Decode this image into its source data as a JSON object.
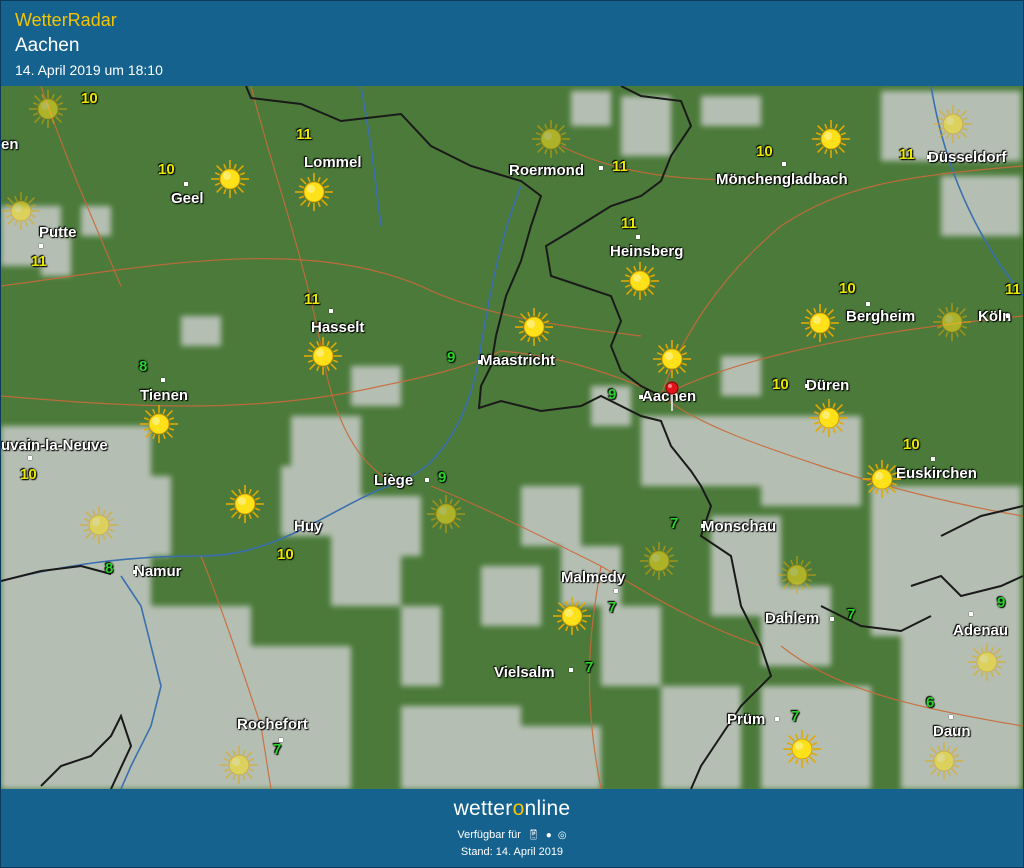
{
  "header": {
    "brand": "WetterRadar",
    "location": "Aachen",
    "datetime": "14. April 2019 um 18:10"
  },
  "colors": {
    "header_bg": "#15628f",
    "brand_accent": "#f5c400",
    "land": "#4b7a3a",
    "cloud": "#c8cbc8",
    "temp_yellow": "#e8e800",
    "temp_green": "#28d42a",
    "border_line": "#1a1a1a",
    "road_line": "#c96a3a",
    "river_line": "#3a6fb0",
    "pin": "#e0141c"
  },
  "map": {
    "cities": [
      {
        "name": "en",
        "dot": false
      },
      {
        "name": "Lommel",
        "dot": false
      },
      {
        "name": "Roermond",
        "dot": true
      },
      {
        "name": "Mönchengladbach",
        "dot": true
      },
      {
        "name": "Düsseldorf",
        "dot": true
      },
      {
        "name": "Geel",
        "dot": true
      },
      {
        "name": "Putte",
        "dot": true
      },
      {
        "name": "Heinsberg",
        "dot": true
      },
      {
        "name": "Hasselt",
        "dot": true
      },
      {
        "name": "Bergheim",
        "dot": true
      },
      {
        "name": "Köln",
        "dot": true
      },
      {
        "name": "Maastricht",
        "dot": true
      },
      {
        "name": "Tienen",
        "dot": true
      },
      {
        "name": "Aachen",
        "dot": true
      },
      {
        "name": "Düren",
        "dot": true
      },
      {
        "name": "uvain-la-Neuve",
        "dot": true
      },
      {
        "name": "Liège",
        "dot": true
      },
      {
        "name": "Euskirchen",
        "dot": true
      },
      {
        "name": "Huy",
        "dot": false
      },
      {
        "name": "Monschau",
        "dot": true
      },
      {
        "name": "Namur",
        "dot": true
      },
      {
        "name": "Malmedy",
        "dot": true
      },
      {
        "name": "Dahlem",
        "dot": true
      },
      {
        "name": "Adenau",
        "dot": true
      },
      {
        "name": "Vielsalm",
        "dot": true
      },
      {
        "name": "Prüm",
        "dot": true
      },
      {
        "name": "Rochefort",
        "dot": true
      },
      {
        "name": "Daun",
        "dot": true
      }
    ],
    "temperatures": [
      {
        "value": "10",
        "color": "yellow"
      },
      {
        "value": "11",
        "color": "yellow"
      },
      {
        "value": "10",
        "color": "yellow"
      },
      {
        "value": "11",
        "color": "yellow"
      },
      {
        "value": "10",
        "color": "yellow"
      },
      {
        "value": "11",
        "color": "yellow"
      },
      {
        "value": "11",
        "color": "yellow"
      },
      {
        "value": "11",
        "color": "yellow"
      },
      {
        "value": "11",
        "color": "yellow"
      },
      {
        "value": "10",
        "color": "yellow"
      },
      {
        "value": "11",
        "color": "yellow"
      },
      {
        "value": "8",
        "color": "green"
      },
      {
        "value": "9",
        "color": "green"
      },
      {
        "value": "9",
        "color": "green"
      },
      {
        "value": "10",
        "color": "yellow"
      },
      {
        "value": "10",
        "color": "yellow"
      },
      {
        "value": "10",
        "color": "yellow"
      },
      {
        "value": "9",
        "color": "green"
      },
      {
        "value": "10",
        "color": "yellow"
      },
      {
        "value": "7",
        "color": "green"
      },
      {
        "value": "8",
        "color": "green"
      },
      {
        "value": "7",
        "color": "green"
      },
      {
        "value": "7",
        "color": "green"
      },
      {
        "value": "9",
        "color": "green"
      },
      {
        "value": "7",
        "color": "green"
      },
      {
        "value": "7",
        "color": "green"
      },
      {
        "value": "6",
        "color": "green"
      },
      {
        "value": "7",
        "color": "green"
      }
    ],
    "sun_icons": "sun-icon",
    "marker": "location-pin-icon"
  },
  "footer": {
    "logo_part1": "wetter",
    "logo_part2": "o",
    "logo_part3": "nline",
    "availability": "Verfügbar für",
    "platforms": [
      "android-icon",
      "apple-icon",
      "web-icon"
    ],
    "stand": "Stand: 14. April 2019"
  }
}
